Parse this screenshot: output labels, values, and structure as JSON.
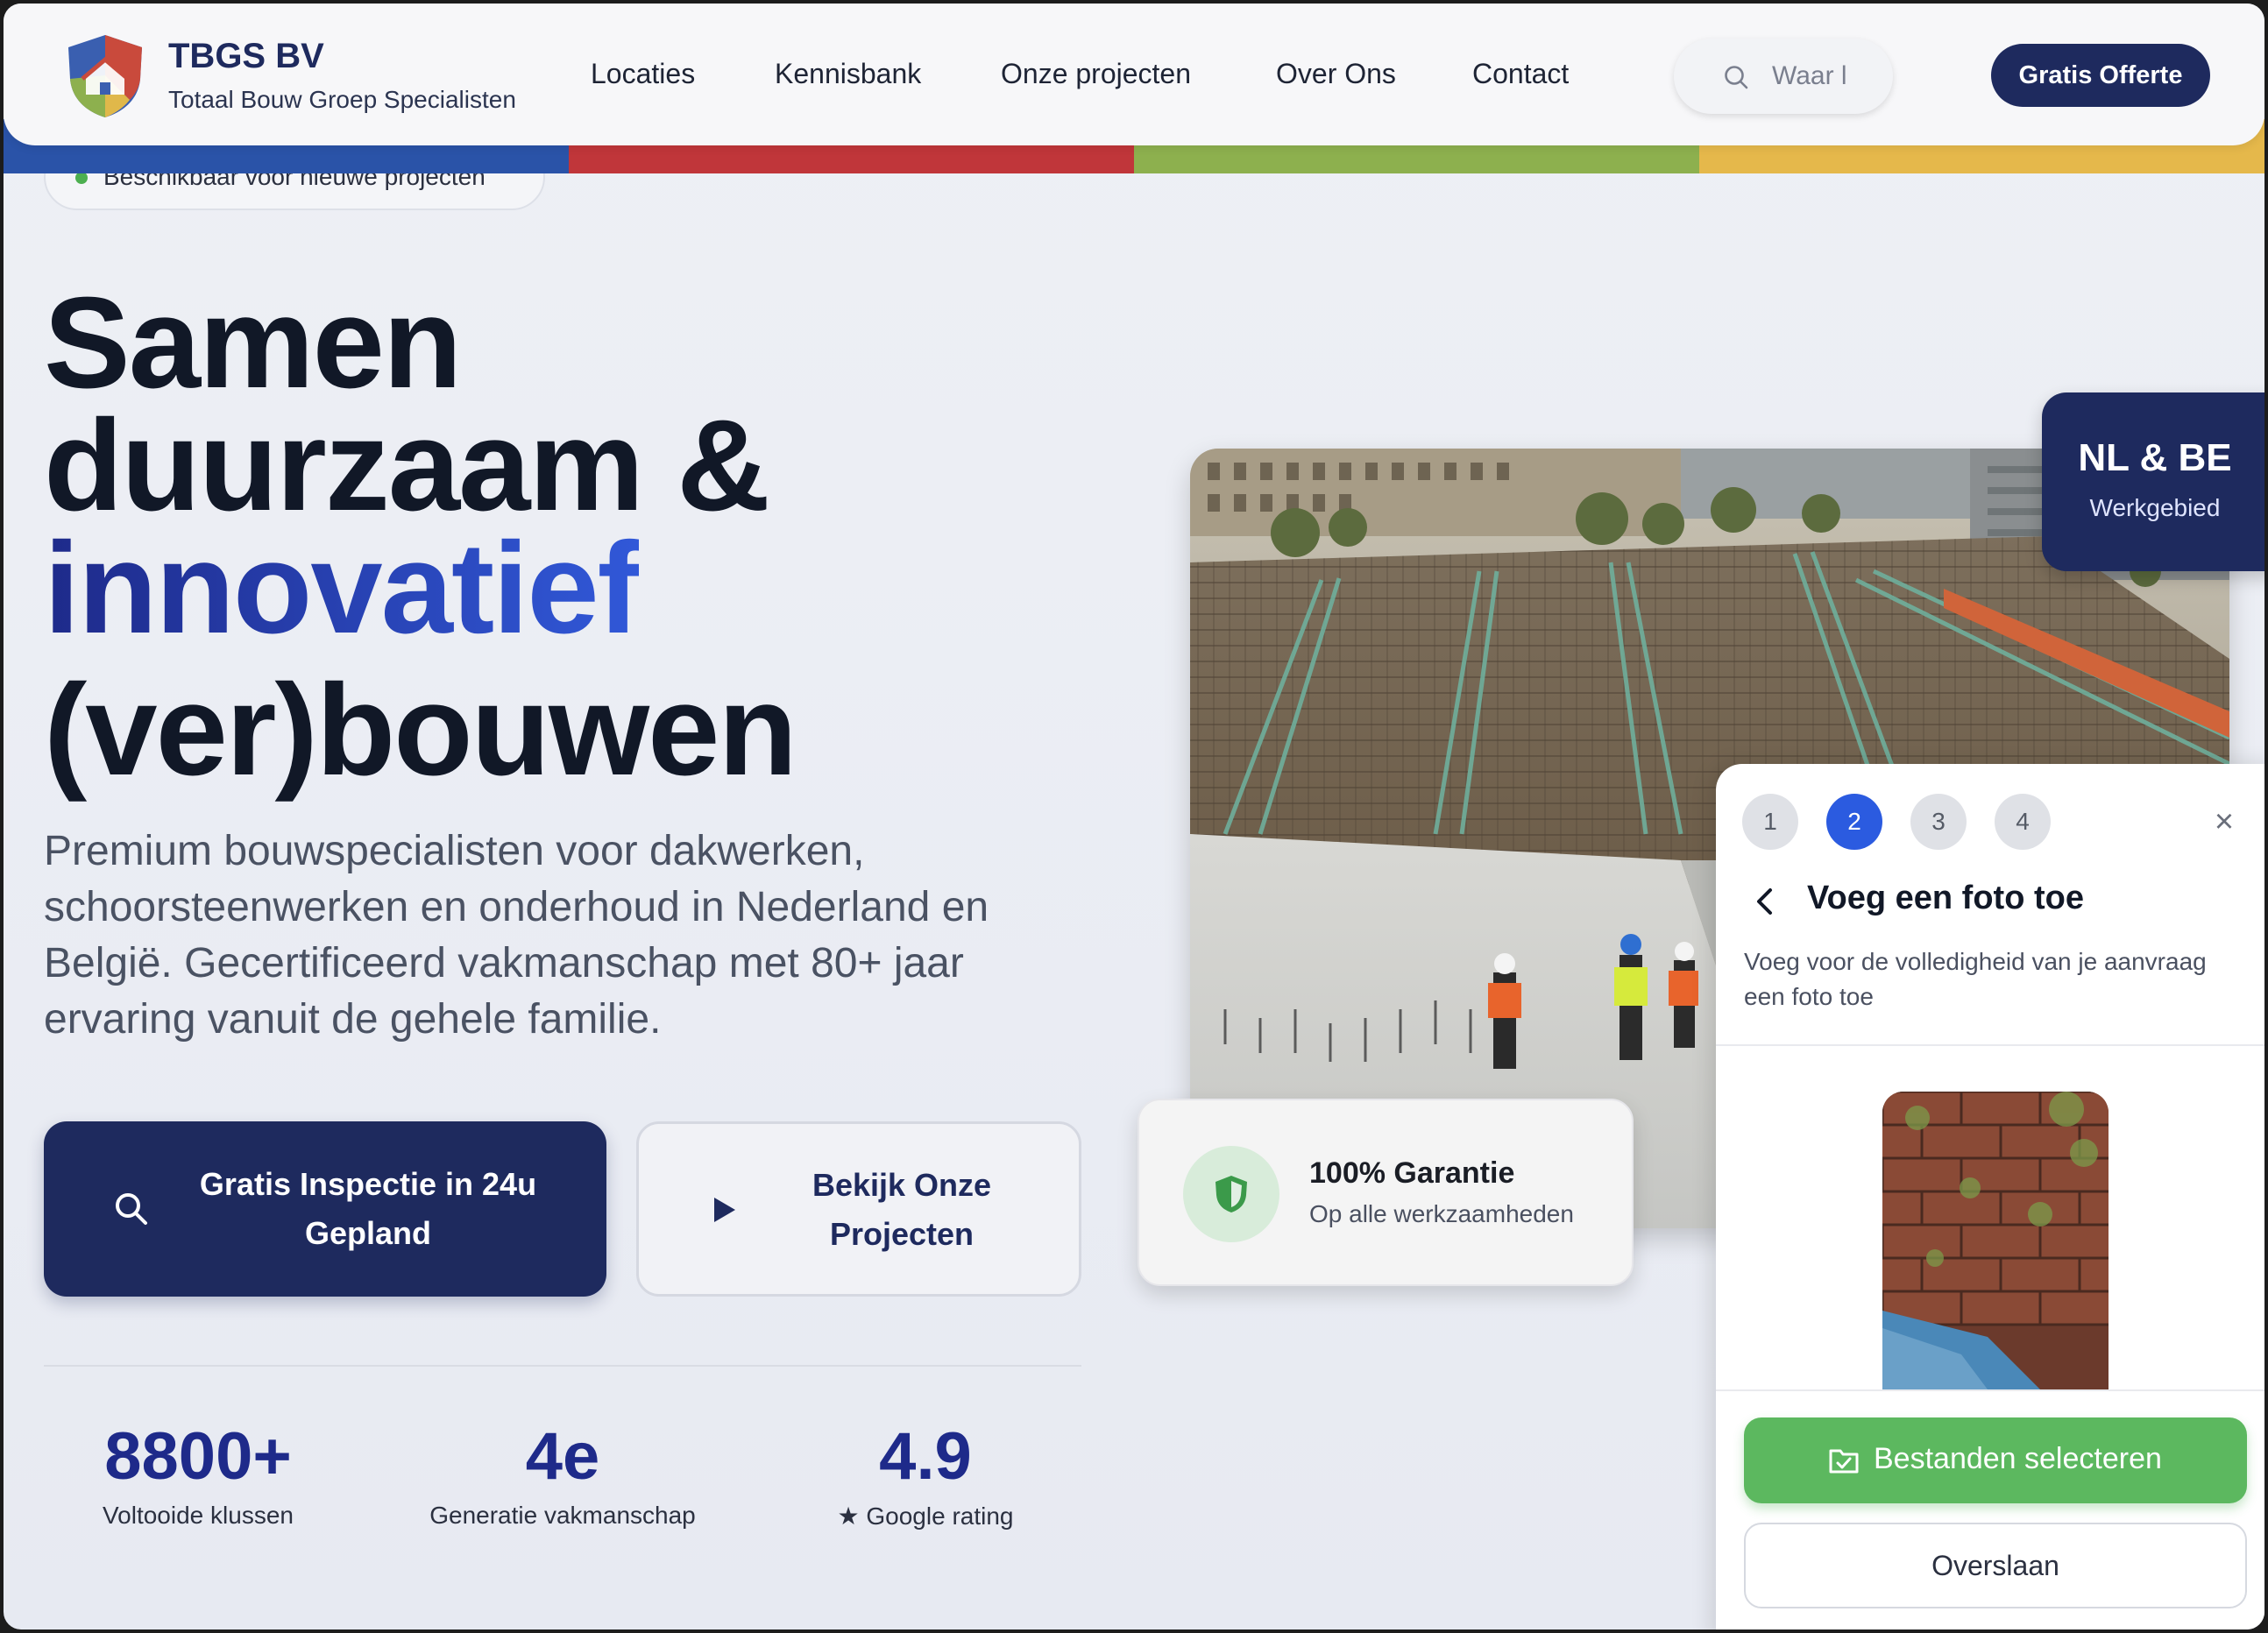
{
  "header": {
    "brand_name": "TBGS BV",
    "brand_sub": "Totaal Bouw Groep Specialisten",
    "nav": [
      "Locaties",
      "Kennisbank",
      "Onze projecten",
      "Over Ons",
      "Contact"
    ],
    "search_placeholder": "Waar l",
    "cta": "Gratis Offerte",
    "stripe_colors": [
      "#2a53a8",
      "#c0363a",
      "#8db04e",
      "#e5b84b"
    ]
  },
  "hero": {
    "badge": "Beschikbaar voor nieuwe projecten",
    "headline": [
      "Samen",
      "duurzaam &",
      "innovatief",
      "(ver)bouwen"
    ],
    "lead": "Premium bouwspecialisten voor dakwerken, schoorsteenwerken en onderhoud in Nederland en België. Gecertificeerd vakmanschap met 80+ jaar ervaring vanuit de gehele familie.",
    "primary_button": "Gratis Inspectie in 24u Gepland",
    "secondary_button": "Bekijk Onze Projecten",
    "stats": [
      {
        "value": "8800+",
        "label": "Voltooide klussen"
      },
      {
        "value": "4e",
        "label": "Generatie vakmanschap"
      },
      {
        "value": "4.9",
        "label": "★ Google rating"
      }
    ]
  },
  "area_badge": {
    "title": "NL & BE",
    "sub": "Werkgebied"
  },
  "guarantee": {
    "title": "100% Garantie",
    "sub": "Op alle werkzaamheden"
  },
  "panel": {
    "steps": [
      "1",
      "2",
      "3",
      "4"
    ],
    "active_step": 2,
    "close": "×",
    "title": "Voeg een foto toe",
    "description": "Voeg voor de volledigheid van je aanvraag een foto toe",
    "select_button": "Bestanden selecteren",
    "skip_button": "Overslaan"
  },
  "colors": {
    "navy": "#1e2a5e",
    "accent_blue": "#2f4fc4",
    "green": "#5cb85f"
  }
}
